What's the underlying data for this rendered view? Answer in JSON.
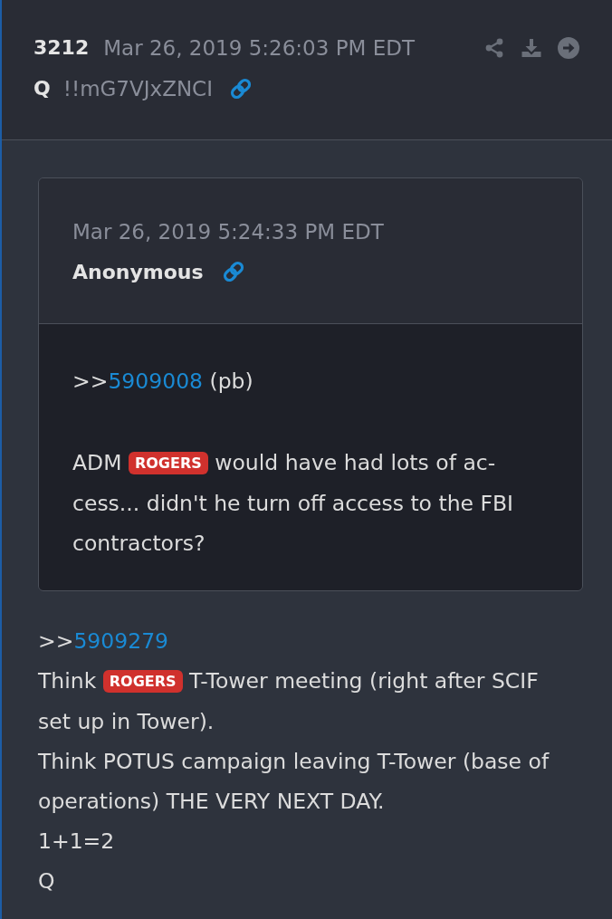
{
  "post": {
    "number": "3212",
    "timestamp": "Mar 26, 2019 5:26:03 PM EDT",
    "author": "Q",
    "tripcode": "!!mG7VJxZNCI"
  },
  "quote": {
    "timestamp": "Mar 26, 2019 5:24:33 PM EDT",
    "author": "Anonymous",
    "paragraphs": [
      [
        {
          "kind": "text",
          "text": ">>"
        },
        {
          "kind": "link",
          "text": "5909008"
        },
        {
          "kind": "text",
          "text": " (pb)"
        }
      ],
      [
        {
          "kind": "text",
          "text": "ADM "
        },
        {
          "kind": "tag",
          "text": "ROGERS"
        },
        {
          "kind": "text",
          "text": " would have had lots of ac-cess... didn't he turn off access to the FBI contractors?"
        }
      ]
    ]
  },
  "body": {
    "paragraphs": [
      [
        {
          "kind": "text",
          "text": ">>"
        },
        {
          "kind": "link",
          "text": "5909279"
        }
      ],
      [
        {
          "kind": "text",
          "text": "Think "
        },
        {
          "kind": "tag",
          "text": "ROGERS"
        },
        {
          "kind": "text",
          "text": " T-Tower meeting (right after SCIF set up in Tower)."
        }
      ],
      [
        {
          "kind": "text",
          "text": "Think POTUS campaign leaving T-Tower (base of operations) THE VERY NEXT DAY."
        }
      ],
      [
        {
          "kind": "text",
          "text": "1+1=2"
        }
      ],
      [
        {
          "kind": "text",
          "text": "Q"
        }
      ]
    ]
  }
}
